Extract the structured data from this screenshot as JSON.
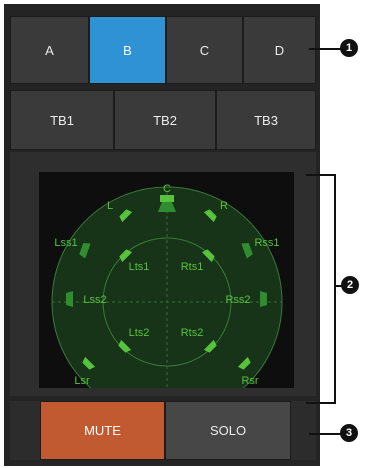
{
  "layout_buttons": [
    "A",
    "B",
    "C",
    "D"
  ],
  "selected_layout": "B",
  "top_buttons": [
    "TB1",
    "TB2",
    "TB3"
  ],
  "speakers": {
    "C": "C",
    "L": "L",
    "R": "R",
    "Lss1": "Lss1",
    "Rss1": "Rss1",
    "Lts1": "Lts1",
    "Rts1": "Rts1",
    "Lss2": "Lss2",
    "Rss2": "Rss2",
    "Lts2": "Lts2",
    "Rts2": "Rts2",
    "Lsr": "Lsr",
    "Rsr": "Rsr"
  },
  "controls": {
    "mute": "MUTE",
    "solo": "SOLO"
  },
  "callouts": [
    "1",
    "2",
    "3"
  ],
  "colors": {
    "selected": "#2f92d4",
    "mute": "#c25a31",
    "speaker_green": "#57c33c",
    "speaker_green_dim": "#2f8c2f"
  }
}
